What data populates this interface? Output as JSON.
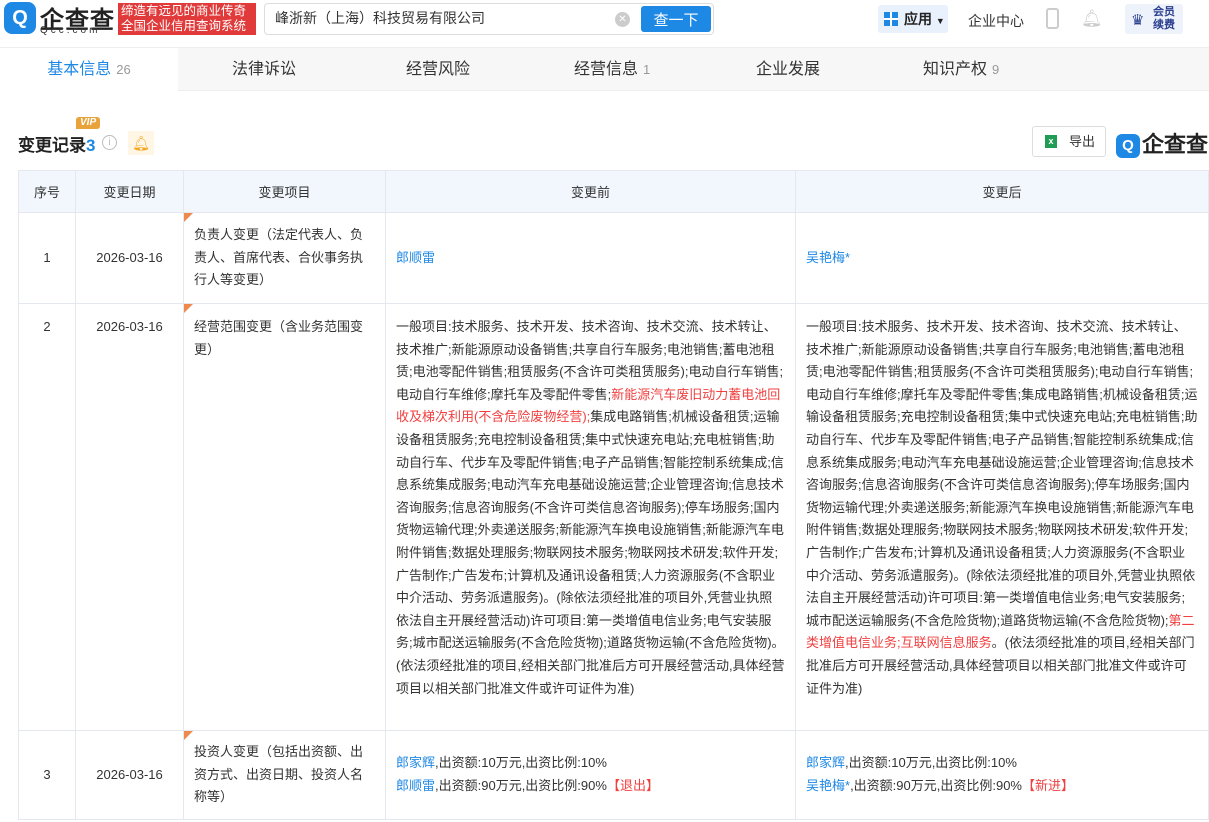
{
  "header": {
    "logo_text": "企查查",
    "logo_domain": "Qcc.com",
    "slogan": [
      "缔造有远见的商业传奇",
      "全国企业信用查询系统"
    ],
    "search_value": "峰浙新（上海）科技贸易有限公司",
    "search_button": "查一下",
    "apps": "应用",
    "corp_center": "企业中心",
    "vip_renew": [
      "会员",
      "续费"
    ]
  },
  "tabs": [
    {
      "label": "基本信息",
      "count": "26"
    },
    {
      "label": "法律诉讼",
      "count": ""
    },
    {
      "label": "经营风险",
      "count": ""
    },
    {
      "label": "经营信息",
      "count": "1"
    },
    {
      "label": "企业发展",
      "count": ""
    },
    {
      "label": "知识产权",
      "count": "9"
    }
  ],
  "section": {
    "title": "变更记录",
    "count": "3",
    "vip": "VIP",
    "export": "导出",
    "watermark": "企查查"
  },
  "table": {
    "headers": [
      "序号",
      "变更日期",
      "变更项目",
      "变更前",
      "变更后"
    ],
    "rows": [
      {
        "no": "1",
        "date": "2026-03-16",
        "item": "负责人变更（法定代表人、负责人、首席代表、合伙事务执行人等变更）",
        "before": "郎顺雷",
        "after": "吴艳梅*"
      },
      {
        "no": "2",
        "date": "2026-03-16",
        "item": "经营范围变更（含业务范围变更）",
        "before": [
          "一般项目:技术服务、技术开发、技术咨询、技术交流、技术转让、技术推广;新能源原动设备销售;共享自行车服务;电池销售;蓄电池租赁;电池零配件销售;租赁服务(不含许可类租赁服务);电动自行车销售;电动自行车维修;摩托车及零配件零售;",
          "新能源汽车废旧动力蓄电池回收及梯次利用(不含危险废物经营);",
          "集成电路销售;机械设备租赁;运输设备租赁服务;充电控制设备租赁;集中式快速充电站;充电桩销售;助动自行车、代步车及零配件销售;电子产品销售;智能控制系统集成;信息系统集成服务;电动汽车充电基础设施运营;企业管理咨询;信息技术咨询服务;信息咨询服务(不含许可类信息咨询服务);停车场服务;国内货物运输代理;外卖递送服务;新能源汽车换电设施销售;新能源汽车电附件销售;数据处理服务;物联网技术服务;物联网技术研发;软件开发;广告制作;广告发布;计算机及通讯设备租赁;人力资源服务(不含职业中介活动、劳务派遣服务)。(除依法须经批准的项目外,凭营业执照依法自主开展经营活动)许可项目:第一类增值电信业务;电气安装服务;城市配送运输服务(不含危险货物);道路货物运输(不含危险货物)。(依法须经批准的项目,经相关部门批准后方可开展经营活动,具体经营项目以相关部门批准文件或许可证件为准)"
        ],
        "after": [
          "一般项目:技术服务、技术开发、技术咨询、技术交流、技术转让、技术推广;新能源原动设备销售;共享自行车服务;电池销售;蓄电池租赁;电池零配件销售;租赁服务(不含许可类租赁服务);电动自行车销售;电动自行车维修;摩托车及零配件零售;集成电路销售;机械设备租赁;运输设备租赁服务;充电控制设备租赁;集中式快速充电站;充电桩销售;助动自行车、代步车及零配件销售;电子产品销售;智能控制系统集成;信息系统集成服务;电动汽车充电基础设施运营;企业管理咨询;信息技术咨询服务;信息咨询服务(不含许可类信息咨询服务);停车场服务;国内货物运输代理;外卖递送服务;新能源汽车换电设施销售;新能源汽车电附件销售;数据处理服务;物联网技术服务;物联网技术研发;软件开发;广告制作;广告发布;计算机及通讯设备租赁;人力资源服务(不含职业中介活动、劳务派遣服务)。(除依法须经批准的项目外,凭营业执照依法自主开展经营活动)许可项目:第一类增值电信业务;电气安装服务;城市配送运输服务(不含危险货物);道路货物运输(不含危险货物);",
          "第二类增值电信业务;互联网信息服务",
          "。(依法须经批准的项目,经相关部门批准后方可开展经营活动,具体经营项目以相关部门批准文件或许可证件为准)"
        ]
      },
      {
        "no": "3",
        "date": "2026-03-16",
        "item": "投资人变更（包括出资额、出资方式、出资日期、投资人名称等）",
        "before": [
          {
            "name": "郎家辉",
            "detail": ",出资额:10万元,出资比例:10%",
            "tag": ""
          },
          {
            "name": "郎顺雷",
            "detail": ",出资额:90万元,出资比例:90%",
            "tag": "【退出】"
          }
        ],
        "after": [
          {
            "name": "郎家辉",
            "detail": ",出资额:10万元,出资比例:10%",
            "tag": ""
          },
          {
            "name": "吴艳梅*",
            "detail": ",出资额:90万元,出资比例:90%",
            "tag": "【新进】"
          }
        ]
      }
    ]
  }
}
